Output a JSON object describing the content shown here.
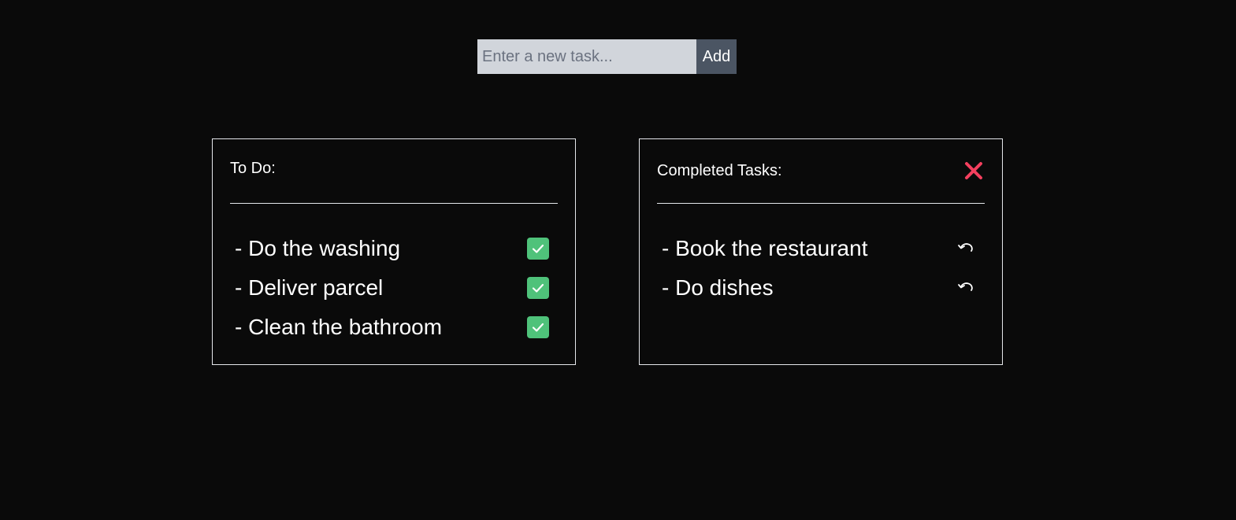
{
  "new_task": {
    "placeholder": "Enter a new task...",
    "value": "",
    "add_label": "Add"
  },
  "todo": {
    "title": "To Do:",
    "items": [
      {
        "label": "- Do the washing",
        "icon": "check-icon"
      },
      {
        "label": "- Deliver parcel",
        "icon": "check-icon"
      },
      {
        "label": "- Clean the bathroom",
        "icon": "check-icon"
      }
    ]
  },
  "completed": {
    "title": "Completed Tasks:",
    "clear_icon": "close-icon",
    "items": [
      {
        "label": "- Book the restaurant",
        "icon": "undo-icon"
      },
      {
        "label": "- Do dishes",
        "icon": "undo-icon"
      }
    ]
  },
  "colors": {
    "background": "#0a0a0a",
    "input_bg": "#d1d5db",
    "button_bg": "#4b5563",
    "check_green": "#4fc27a",
    "clear_red": "#f43f5e"
  }
}
